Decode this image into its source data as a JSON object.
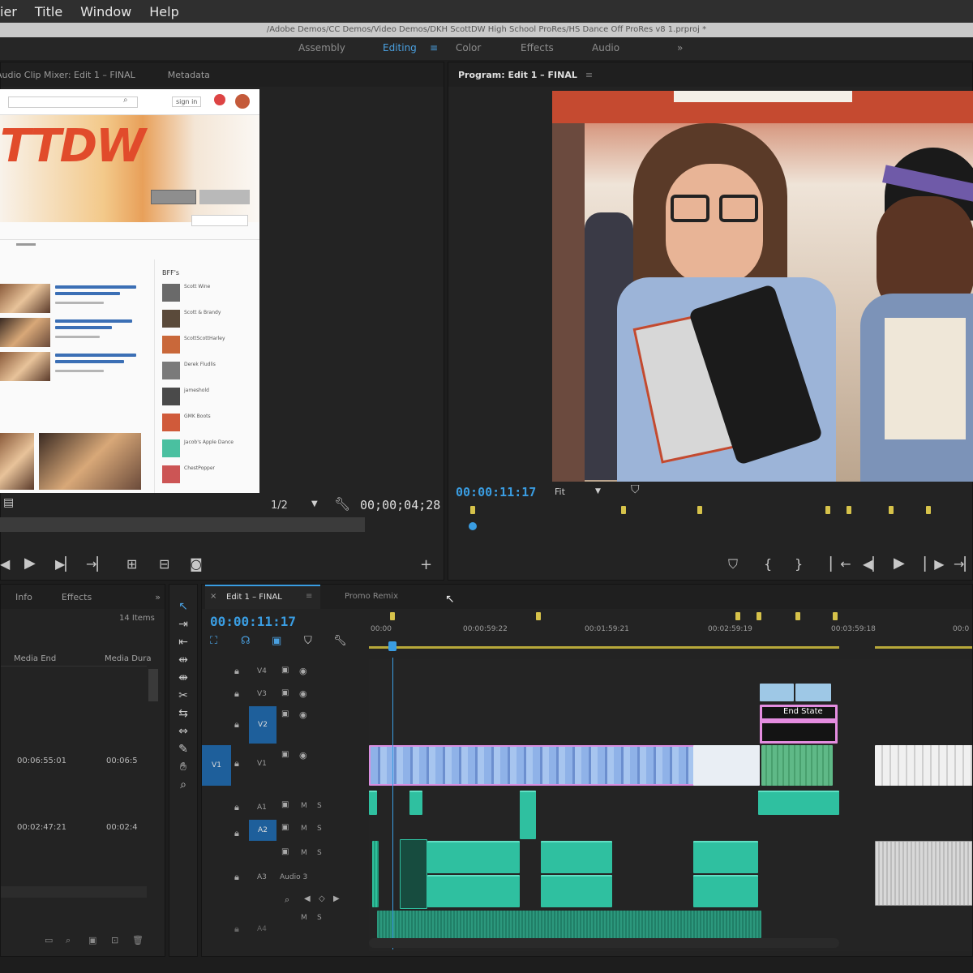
{
  "menu": [
    "ier",
    "Title",
    "Window",
    "Help"
  ],
  "window_title": "/Adobe Demos/CC Demos/Video Demos/DKH ScottDW High School ProRes/HS Dance Off ProRes v8 1.prproj *",
  "workspaces": [
    {
      "label": "Assembly",
      "active": false
    },
    {
      "label": "Editing",
      "active": true
    },
    {
      "label": "Color",
      "active": false
    },
    {
      "label": "Effects",
      "active": false
    },
    {
      "label": "Audio",
      "active": false
    }
  ],
  "workspace_more": "»",
  "source_monitor": {
    "tabs": [
      "Audio Clip Mixer: Edit 1 – FINAL",
      "Metadata"
    ],
    "fraction": "1/2",
    "timecode": "00;00;04;28"
  },
  "program_monitor": {
    "title": "Program: Edit 1 – FINAL",
    "timecode": "00:00:11:17",
    "fit": "Fit"
  },
  "project_panel": {
    "tabs": [
      "Info",
      "Effects"
    ],
    "more": "»",
    "item_count": "14 Items",
    "columns": [
      "Media End",
      "Media Dura"
    ],
    "rows": [
      {
        "end": "00:06:55:01",
        "duration": "00:06:5"
      },
      {
        "end": "00:02:47:21",
        "duration": "00:02:4"
      }
    ]
  },
  "timeline": {
    "tabs": [
      {
        "label": "Edit 1 – FINAL",
        "active": true
      },
      {
        "label": "Promo Remix",
        "active": false
      }
    ],
    "timecode": "00:00:11:17",
    "ruler": [
      "00:00",
      "00:00:59:22",
      "00:01:59:21",
      "00:02:59:19",
      "00:03:59:18",
      "00:0"
    ],
    "tracks": {
      "v4": "V4",
      "v3": "V3",
      "v2": "V2",
      "v1": "V1",
      "a1": "A1",
      "a2": "A2",
      "a3": "A3",
      "a3_name": "Audio 3",
      "a4": "A4",
      "source_v1": "V1"
    },
    "clip_label": "End State",
    "m_label": "M",
    "s_label": "S"
  },
  "website": {
    "login": "sign in",
    "logo": "TTDW",
    "sidebar_title": "BFF's",
    "channels": [
      "Scott Wine",
      "Scott & Brandy",
      "ScottScottHarley",
      "Derek Fludlis",
      "jameshold",
      "GMK Boots",
      "Jacob's Apple Dance",
      "ChestPopper"
    ],
    "video_titles": [
      "Girl Lady Dancer (Essential Spotifier & GetVD) - 4K",
      "Girl Bad Professor - Watch Him Now (4K)",
      "Girl Wired Dance Battle: Goodbye vs Caitlan (4K)"
    ]
  },
  "colors": {
    "accent": "#3a9de2",
    "video_clip": "#8fb2e8",
    "audio_clip": "#2fc0a0",
    "track_target": "#1e5f9b"
  }
}
